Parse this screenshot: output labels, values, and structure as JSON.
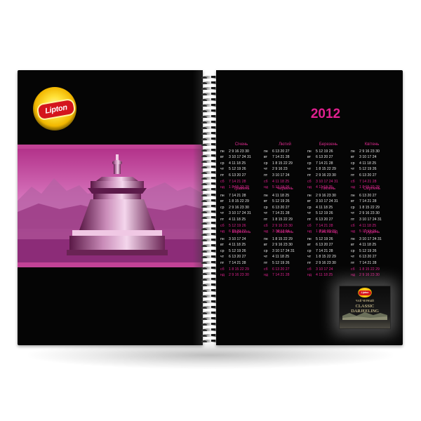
{
  "brand": "Lipton",
  "year": "2012",
  "day_labels": [
    "пн",
    "вт",
    "ср",
    "чт",
    "пт",
    "сб",
    "нд"
  ],
  "colors": {
    "accent": "#e0208f",
    "page": "#050505"
  },
  "months": [
    {
      "name": "Січень",
      "rows": [
        "2 9 16 23 30",
        "3 10 17 24 31",
        "4 11 18 25",
        "5 12 19 26",
        "6 13 20 27",
        "7 14 21 28",
        "1 8 15 22 29"
      ]
    },
    {
      "name": "Лютий",
      "rows": [
        "6 13 20 27",
        "7 14 21 28",
        "1 8 15 22 29",
        "2 9 16 23",
        "3 10 17 24",
        "4 11 18 25",
        "5 12 19 26"
      ]
    },
    {
      "name": "Березень",
      "rows": [
        "5 12 19 26",
        "6 13 20 27",
        "7 14 21 28",
        "1 8 15 22 29",
        "2 9 16 23 30",
        "3 10 17 24 31",
        "4 11 18 25"
      ]
    },
    {
      "name": "Квітень",
      "rows": [
        "2 9 16 23 30",
        "3 10 17 24",
        "4 11 18 25",
        "5 12 19 26",
        "6 13 20 27",
        "7 14 21 28",
        "1 8 15 22 29"
      ]
    },
    {
      "name": "Травень",
      "rows": [
        "7 14 21 28",
        "1 8 15 22 29",
        "2 9 16 23 30",
        "3 10 17 24 31",
        "4 11 18 25",
        "5 12 19 26",
        "6 13 20 27"
      ]
    },
    {
      "name": "Червень",
      "rows": [
        "4 11 18 25",
        "5 12 19 26",
        "6 13 20 27",
        "7 14 21 28",
        "1 8 15 22 29",
        "2 9 16 23 30",
        "3 10 17 24"
      ]
    },
    {
      "name": "Липень",
      "rows": [
        "2 9 16 23 30",
        "3 10 17 24 31",
        "4 11 18 25",
        "5 12 19 26",
        "6 13 20 27",
        "7 14 21 28",
        "1 8 15 22 29"
      ]
    },
    {
      "name": "Серпень",
      "rows": [
        "6 13 20 27",
        "7 14 21 28",
        "1 8 15 22 29",
        "2 9 16 23 30",
        "3 10 17 24 31",
        "4 11 18 25",
        "5 12 19 26"
      ]
    },
    {
      "name": "Вересень",
      "rows": [
        "3 10 17 24",
        "4 11 18 25",
        "5 12 19 26",
        "6 13 20 27",
        "7 14 21 28",
        "1 8 15 22 29",
        "2 9 16 23 30"
      ]
    },
    {
      "name": "Жовтень",
      "rows": [
        "1 8 15 22 29",
        "2 9 16 23 30",
        "3 10 17 24 31",
        "4 11 18 25",
        "5 12 19 26",
        "6 13 20 27",
        "7 14 21 28"
      ]
    },
    {
      "name": "Листопад",
      "rows": [
        "5 12 19 26",
        "6 13 20 27",
        "7 14 21 28",
        "1 8 15 22 29",
        "2 9 16 23 30",
        "3 10 17 24",
        "4 11 18 25"
      ]
    },
    {
      "name": "Грудень",
      "rows": [
        "3 10 17 24 31",
        "4 11 18 25",
        "5 12 19 26",
        "6 13 20 27",
        "7 14 21 28",
        "1 8 15 22 29",
        "2 9 16 23 30"
      ]
    }
  ],
  "pack": {
    "brand": "Lipton",
    "line": "ЧАЙ ЧЕРНЫЙ",
    "title_1": "CLASSIC",
    "title_2": "DARJEELING"
  }
}
